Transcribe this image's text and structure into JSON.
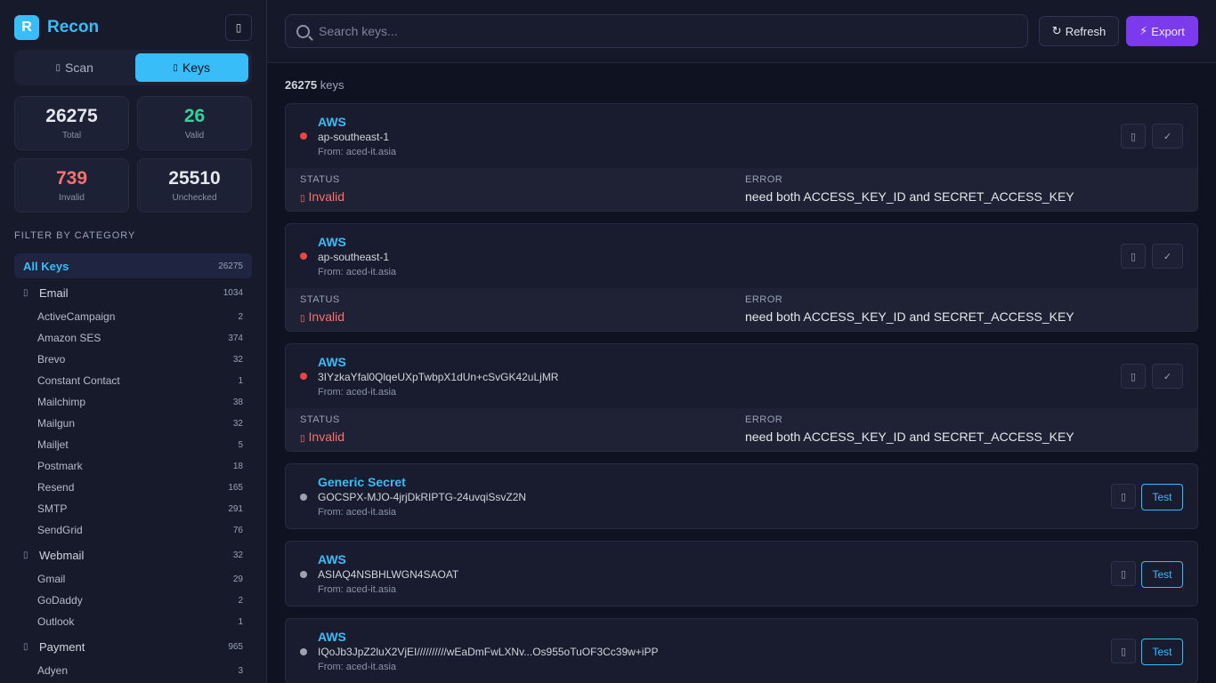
{
  "app": {
    "logo_letter": "R",
    "name": "Recon",
    "toggle_icon": "▯"
  },
  "mode_tabs": [
    {
      "icon": "▯",
      "label": "Scan",
      "active": false
    },
    {
      "icon": "▯",
      "label": "Keys",
      "active": true
    }
  ],
  "stats": {
    "total": {
      "value": "26275",
      "label": "Total"
    },
    "valid": {
      "value": "26",
      "label": "Valid"
    },
    "invalid": {
      "value": "739",
      "label": "Invalid"
    },
    "unchecked": {
      "value": "25510",
      "label": "Unchecked"
    }
  },
  "filter": {
    "title": "FILTER BY CATEGORY",
    "all": {
      "name": "All Keys",
      "count": "26275"
    },
    "groups": [
      {
        "icon": "▯",
        "name": "Email",
        "count": "1034",
        "items": [
          {
            "name": "ActiveCampaign",
            "count": "2"
          },
          {
            "name": "Amazon SES",
            "count": "374"
          },
          {
            "name": "Brevo",
            "count": "32"
          },
          {
            "name": "Constant Contact",
            "count": "1"
          },
          {
            "name": "Mailchimp",
            "count": "38"
          },
          {
            "name": "Mailgun",
            "count": "32"
          },
          {
            "name": "Mailjet",
            "count": "5"
          },
          {
            "name": "Postmark",
            "count": "18"
          },
          {
            "name": "Resend",
            "count": "165"
          },
          {
            "name": "SMTP",
            "count": "291"
          },
          {
            "name": "SendGrid",
            "count": "76"
          }
        ]
      },
      {
        "icon": "▯",
        "name": "Webmail",
        "count": "32",
        "items": [
          {
            "name": "Gmail",
            "count": "29"
          },
          {
            "name": "GoDaddy",
            "count": "2"
          },
          {
            "name": "Outlook",
            "count": "1"
          }
        ]
      },
      {
        "icon": "▯",
        "name": "Payment",
        "count": "965",
        "items": [
          {
            "name": "Adyen",
            "count": "3"
          }
        ]
      }
    ]
  },
  "toolbar": {
    "search_placeholder": "Search keys...",
    "refresh_icon": "↻",
    "refresh_label": "Refresh",
    "export_icon": "⚡",
    "export_label": "Export"
  },
  "summary": {
    "count": "26275",
    "suffix": "keys"
  },
  "labels": {
    "status": "STATUS",
    "error": "ERROR",
    "copy_icon": "▯",
    "check_icon": "✓",
    "test": "Test",
    "invalid_icon": "▯"
  },
  "keys": [
    {
      "type": "AWS",
      "value": "ap-southeast-1",
      "from": "From: aced-it.asia",
      "status_dot": "red",
      "status": "Invalid",
      "error": "need both ACCESS_KEY_ID and SECRET_ACCESS_KEY"
    },
    {
      "type": "AWS",
      "value": "ap-southeast-1",
      "from": "From: aced-it.asia",
      "status_dot": "red",
      "status": "Invalid",
      "error": "need both ACCESS_KEY_ID and SECRET_ACCESS_KEY"
    },
    {
      "type": "AWS",
      "value": "3IYzkaYfal0QlqeUXpTwbpX1dUn+cSvGK42uLjMR",
      "from": "From: aced-it.asia",
      "status_dot": "red",
      "status": "Invalid",
      "error": "need both ACCESS_KEY_ID and SECRET_ACCESS_KEY"
    },
    {
      "type": "Generic Secret",
      "value": "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",
      "from": "From: aced-it.asia",
      "status_dot": "gray"
    },
    {
      "type": "AWS",
      "value": "ASIAQ4NSBHLWGN4SAOAT",
      "from": "From: aced-it.asia",
      "status_dot": "gray"
    },
    {
      "type": "AWS",
      "value": "IQoJb3JpZ2luX2VjEI//////////wEaDmFwLXNv...Os955oTuOF3Cc39w+iPP",
      "from": "From: aced-it.asia",
      "status_dot": "gray"
    }
  ]
}
